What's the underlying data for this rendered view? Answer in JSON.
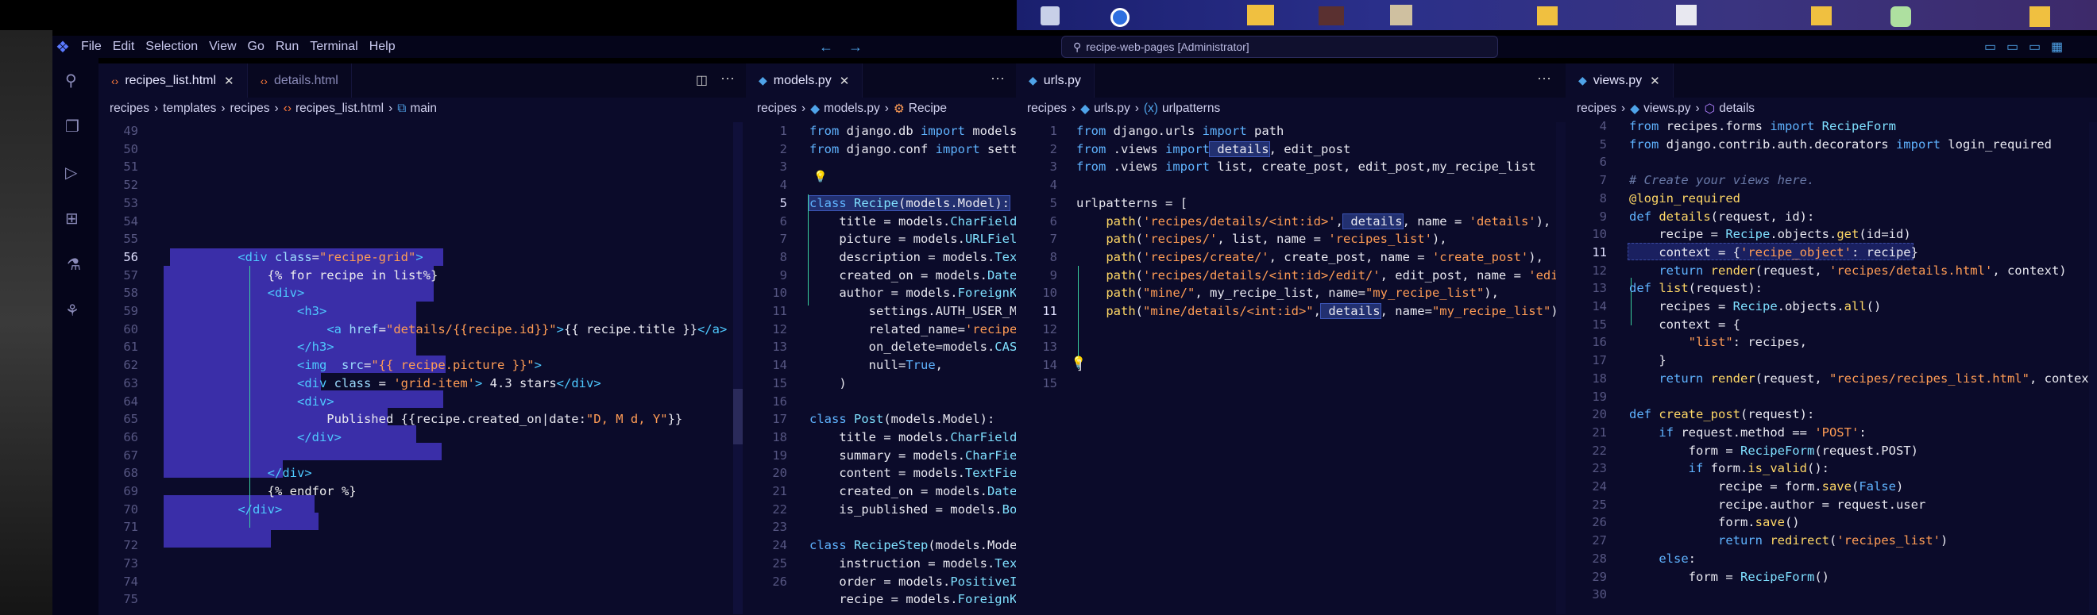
{
  "menubar": {
    "items": [
      "File",
      "Edit",
      "Selection",
      "View",
      "Go",
      "Run",
      "Terminal",
      "Help"
    ]
  },
  "titlebar": {
    "search": "recipe-web-pages [Administrator]"
  },
  "left": {
    "tabs": [
      {
        "label": "recipes_list.html"
      },
      {
        "label": "details.html"
      }
    ],
    "breadcrumb": [
      "recipes",
      "templates",
      "recipes",
      "recipes_list.html",
      "main"
    ],
    "lines": [
      "49",
      "50",
      "51",
      "52",
      "53",
      "54",
      "55",
      "56",
      "57",
      "58",
      "59",
      "60",
      "61",
      "62",
      "63",
      "64",
      "65",
      "66",
      "67",
      "68",
      "69",
      "70",
      "71",
      "72",
      "73",
      "74",
      "75"
    ]
  },
  "models": {
    "tab": "models.py",
    "breadcrumb": [
      "recipes",
      "models.py",
      "Recipe"
    ],
    "lines": [
      "1",
      "2",
      "3",
      "4",
      "5",
      "6",
      "7",
      "8",
      "9",
      "10",
      "11",
      "12",
      "13",
      "14",
      "15",
      "16",
      "17",
      "18",
      "19",
      "20",
      "21",
      "22",
      "23",
      "24",
      "25",
      "26"
    ]
  },
  "urls": {
    "tab": "urls.py",
    "breadcrumb": [
      "recipes",
      "urls.py",
      "urlpatterns"
    ],
    "lines": [
      "1",
      "2",
      "3",
      "4",
      "5",
      "6",
      "7",
      "8",
      "9",
      "10",
      "11",
      "12",
      "13",
      "14",
      "15"
    ]
  },
  "views": {
    "tab": "views.py",
    "breadcrumb": [
      "recipes",
      "views.py",
      "details"
    ],
    "lines": [
      "4",
      "5",
      "6",
      "7",
      "8",
      "9",
      "10",
      "11",
      "12",
      "13",
      "14",
      "15",
      "16",
      "17",
      "18",
      "19",
      "20",
      "21",
      "22",
      "23",
      "24",
      "25",
      "26",
      "27",
      "28",
      "29",
      "30"
    ]
  }
}
